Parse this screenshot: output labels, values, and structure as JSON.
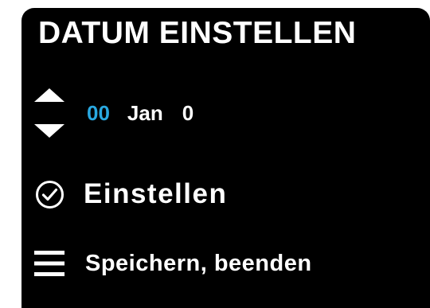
{
  "screen": {
    "title": "DATUM EINSTELLEN"
  },
  "date_row": {
    "icon": "up-down-arrows-icon",
    "day": "00",
    "month": "Jan",
    "year": "0"
  },
  "menu": {
    "set": {
      "icon": "check-circle-icon",
      "label": "Einstellen"
    },
    "save": {
      "icon": "menu-lines-icon",
      "label": "Speichern, beenden"
    }
  },
  "colors": {
    "background": "#000000",
    "text": "#ffffff",
    "accent": "#29a8e0",
    "page": "#ffffff"
  }
}
